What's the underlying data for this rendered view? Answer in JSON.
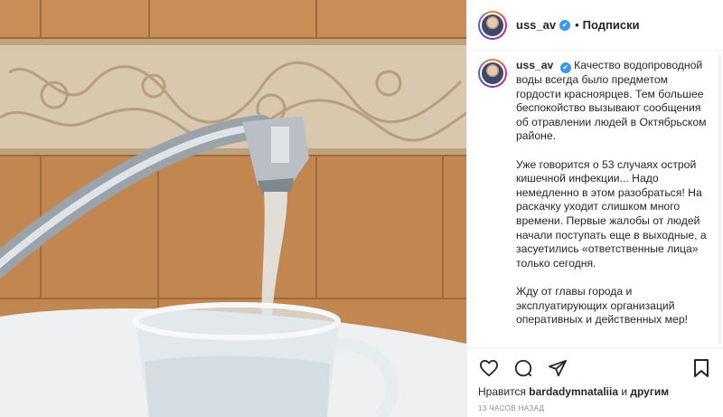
{
  "photo": {
    "alt_icon": "faucet-water-glass-photo"
  },
  "header": {
    "username": "uss_av",
    "separator": "•",
    "follow_label": "Подписки"
  },
  "caption": {
    "username": "uss_av",
    "paragraph_1": "Качество водопроводной воды всегда было предметом гордости красноярцев. Тем большее беспокойство вызывают сообщения об отравлении людей в Октябрьском районе.",
    "paragraph_2": "Уже говорится о 53 случаях острой кишечной инфекции... Надо немедленно в этом разобраться! На раскачку уходит слишком много времени. Первые жалобы от людей начали поступать еще в выходные, а засуетились «ответственные лица» только сегодня.",
    "paragraph_3": "Жду от главы города и эксплуатирующих организаций оперативных и действенных мер!"
  },
  "actions": {
    "icons": [
      "heart-icon",
      "comment-icon",
      "share-icon",
      "bookmark-icon"
    ]
  },
  "likes": {
    "prefix": "Нравится",
    "liker": "bardadymnataliia",
    "and": "и",
    "others": "другим"
  },
  "timestamp": "13 ЧАСОВ НАЗАД"
}
